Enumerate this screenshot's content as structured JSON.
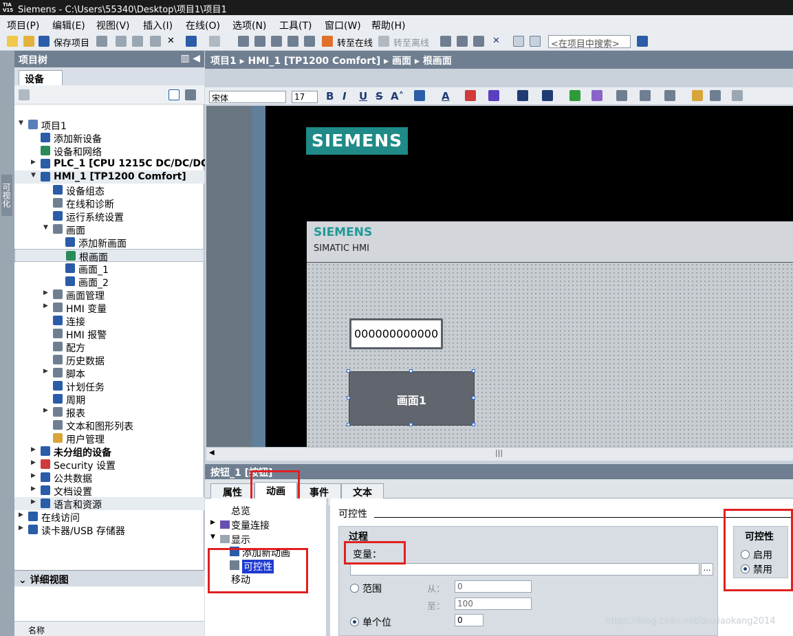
{
  "titlebar": {
    "logo": "TIA\nV15",
    "title": "Siemens  -  C:\\Users\\55340\\Desktop\\项目1\\项目1"
  },
  "menu": [
    "项目(P)",
    "编辑(E)",
    "视图(V)",
    "插入(I)",
    "在线(O)",
    "选项(N)",
    "工具(T)",
    "窗口(W)",
    "帮助(H)"
  ],
  "toolbar": {
    "save": "保存项目",
    "go_online": "转至在线",
    "go_offline": "转至离线",
    "search_placeholder": "<在项目中搜索>"
  },
  "side_strip": "可视化",
  "project_tree": {
    "title": "项目树",
    "tab": "设备",
    "items": [
      {
        "label": "项目1",
        "level": 0,
        "arrow": "▼"
      },
      {
        "label": "添加新设备",
        "level": 1,
        "arrow": ""
      },
      {
        "label": "设备和网络",
        "level": 1,
        "arrow": ""
      },
      {
        "label": "PLC_1 [CPU 1215C DC/DC/DC]",
        "level": 1,
        "arrow": "▶"
      },
      {
        "label": "HMI_1 [TP1200 Comfort]",
        "level": 1,
        "arrow": "▼"
      },
      {
        "label": "设备组态",
        "level": 2,
        "arrow": ""
      },
      {
        "label": "在线和诊断",
        "level": 2,
        "arrow": ""
      },
      {
        "label": "运行系统设置",
        "level": 2,
        "arrow": ""
      },
      {
        "label": "画面",
        "level": 2,
        "arrow": "▼"
      },
      {
        "label": "添加新画面",
        "level": 3,
        "arrow": ""
      },
      {
        "label": "根画面",
        "level": 3,
        "arrow": ""
      },
      {
        "label": "画面_1",
        "level": 3,
        "arrow": ""
      },
      {
        "label": "画面_2",
        "level": 3,
        "arrow": ""
      },
      {
        "label": "画面管理",
        "level": 2,
        "arrow": "▶"
      },
      {
        "label": "HMI 变量",
        "level": 2,
        "arrow": "▶"
      },
      {
        "label": "连接",
        "level": 2,
        "arrow": ""
      },
      {
        "label": "HMI 报警",
        "level": 2,
        "arrow": ""
      },
      {
        "label": "配方",
        "level": 2,
        "arrow": ""
      },
      {
        "label": "历史数据",
        "level": 2,
        "arrow": ""
      },
      {
        "label": "脚本",
        "level": 2,
        "arrow": "▶"
      },
      {
        "label": "计划任务",
        "level": 2,
        "arrow": ""
      },
      {
        "label": "周期",
        "level": 2,
        "arrow": ""
      },
      {
        "label": "报表",
        "level": 2,
        "arrow": "▶"
      },
      {
        "label": "文本和图形列表",
        "level": 2,
        "arrow": ""
      },
      {
        "label": "用户管理",
        "level": 2,
        "arrow": ""
      },
      {
        "label": "未分组的设备",
        "level": 1,
        "arrow": "▶"
      },
      {
        "label": "Security 设置",
        "level": 1,
        "arrow": "▶"
      },
      {
        "label": "公共数据",
        "level": 1,
        "arrow": "▶"
      },
      {
        "label": "文档设置",
        "level": 1,
        "arrow": "▶"
      },
      {
        "label": "语言和资源",
        "level": 1,
        "arrow": "▶"
      },
      {
        "label": "在线访问",
        "level": 0,
        "arrow": "▶"
      },
      {
        "label": "读卡器/USB 存储器",
        "level": 0,
        "arrow": "▶"
      }
    ],
    "selected_index": 10
  },
  "detail_view": {
    "title": "详细视图",
    "column": "名称"
  },
  "breadcrumb": [
    "项目1",
    "HMI_1 [TP1200 Comfort]",
    "画面",
    "根画面"
  ],
  "format_bar": {
    "font": "宋体",
    "size": "17"
  },
  "hmi_screen": {
    "logo": "SIEMENS",
    "header_logo": "SIEMENS",
    "header_subtitle": "SIMATIC HMI",
    "io_field_value": "000000000000",
    "button_label": "画面1"
  },
  "inspector": {
    "title": "按钮_1 [按钮]",
    "tabs": [
      "属性",
      "动画",
      "事件",
      "文本"
    ],
    "active_tab": "动画",
    "nav": [
      "总览",
      "变量连接",
      "显示",
      "添加新动画",
      "可控性",
      "移动"
    ],
    "section_title": "可控性",
    "process_title": "过程",
    "variable_label": "变量：",
    "range_label": "范围",
    "from_label": "从：",
    "to_label": "至：",
    "from_value": "0",
    "to_value": "100",
    "single_bit_label": "单个位",
    "bit_value": "0",
    "controllability_title": "可控性",
    "enable_label": "启用",
    "disable_label": "禁用",
    "selected_state": "禁用"
  },
  "watermark": "https://blog.csdn.net/duxiaokang2014",
  "colors": {
    "siemens_teal": "#1f8a87",
    "header_gray": "#6f7f91",
    "highlight_red": "#e02020"
  }
}
